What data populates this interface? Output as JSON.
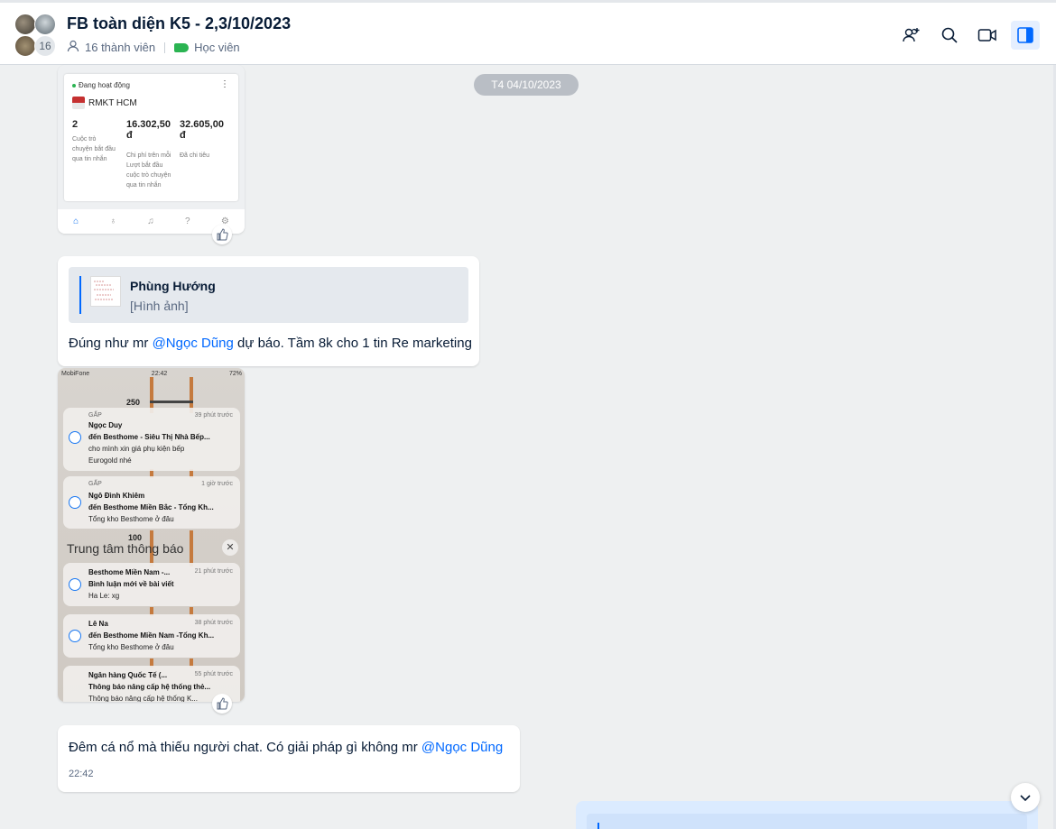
{
  "header": {
    "title": "FB toàn diện K5 - 2,3/10/2023",
    "avatar_count": "16",
    "members": "16 thành viên",
    "tag_label": "Học viên",
    "tag_color": "#2bb452",
    "icons": [
      "add-member-icon",
      "search-icon",
      "video-call-icon",
      "toggle-sidebar-icon"
    ]
  },
  "date_divider": "T4 04/10/2023",
  "shot1": {
    "status": "Đang hoạt động",
    "account": "RMKT HCM",
    "metrics": [
      {
        "value": "2",
        "desc": [
          "Cuộc trò",
          "chuyện bắt đầu",
          "qua tin nhắn"
        ]
      },
      {
        "value": "16.302,50",
        "unit": "đ",
        "desc": [
          "Chi phí trên mỗi",
          "Lượt bắt đầu",
          "cuộc trò chuyện",
          "qua tin nhắn"
        ]
      },
      {
        "value": "32.605,00",
        "unit": "đ",
        "desc": [
          "Đã chi tiêu"
        ]
      }
    ]
  },
  "reply": {
    "quote_name": "Phùng Hướng",
    "quote_sub": "[Hình ảnh]",
    "text_before": "Đúng như mr ",
    "mention": "@Ngọc Dũng",
    "text_after": " dự báo. Tầm 8k cho 1 tin Re marketing"
  },
  "shot2": {
    "carrier": "MobiFone",
    "time": "22:42",
    "battery": "72%",
    "floor_label_1": "250",
    "floor_label_2": "100",
    "center_title": "Trung tâm thông báo",
    "notifications": [
      {
        "meta": "GẤP",
        "time": "39 phút trước",
        "l1": "Ngọc Duy",
        "l2": "đến Besthome - Siêu Thị Nhà Bếp...",
        "l3": "cho mình xin giá phụ kiện bếp",
        "l4": "Eurogold nhé"
      },
      {
        "meta": "GẤP",
        "time": "1 giờ trước",
        "l1": "Ngô Đình Khiêm",
        "l2": "đến Besthome Miền Bắc - Tổng Kh...",
        "l3": "Tổng kho Besthome ở đâu"
      },
      {
        "time": "21 phút trước",
        "l1": "Besthome Miền Nam -...",
        "l2": "Bình luận mới về bài viết",
        "l3": "Ha Le: xg"
      },
      {
        "time": "38 phút trước",
        "l1": "Lê Na",
        "l2": "đến Besthome Miền Nam -Tổng Kh...",
        "l3": "Tổng kho Besthome ở đâu"
      },
      {
        "time": "55 phút trước",
        "l1": "Ngân hàng Quốc Tế (...",
        "l2": "Thông báo nâng cấp hệ thống thẻ...",
        "l3": "Thông báo nâng cấp hệ thống K..."
      }
    ]
  },
  "message2": {
    "text_before": "Đêm cá nổ mà thiếu người chat. Có giải pháp gì không mr ",
    "mention": "@Ngọc Dũng",
    "time": "22:42"
  }
}
